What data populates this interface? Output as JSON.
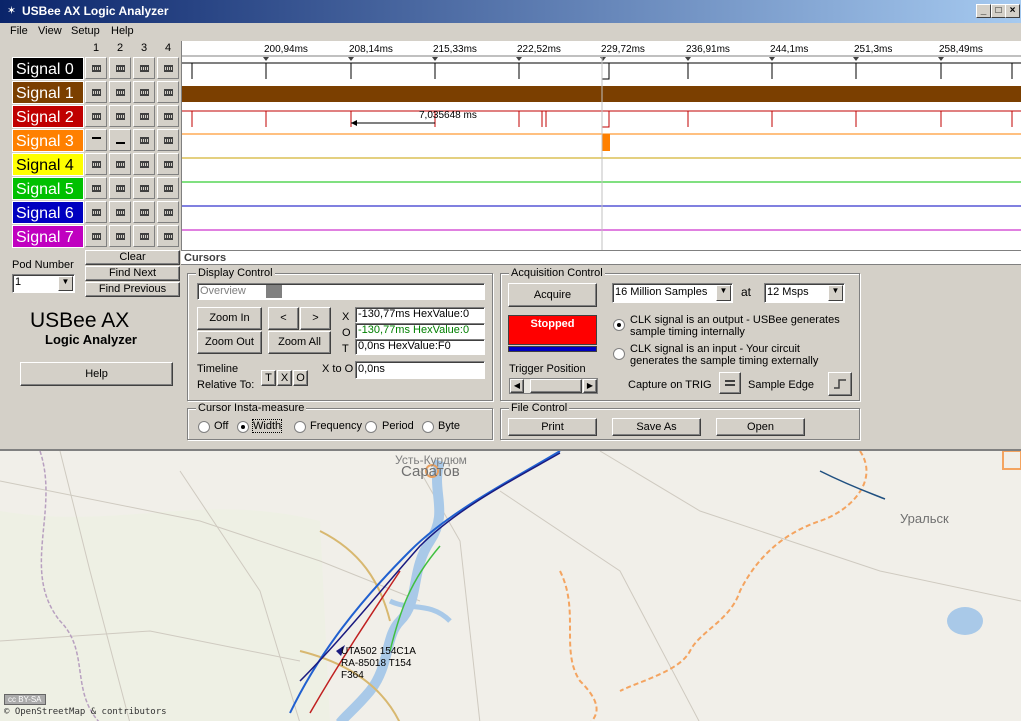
{
  "window": {
    "title": "USBee AX Logic Analyzer",
    "colors": {
      "titlebar": "#0a246a"
    }
  },
  "menu": [
    "File",
    "View",
    "Setup",
    "Help"
  ],
  "column_numbers": [
    "1",
    "2",
    "3",
    "4"
  ],
  "signals": [
    {
      "label": "Signal 0",
      "color": "#000000"
    },
    {
      "label": "Signal 1",
      "color": "#7b3f00"
    },
    {
      "label": "Signal 2",
      "color": "#c00000"
    },
    {
      "label": "Signal 3",
      "color": "#ff8000"
    },
    {
      "label": "Signal 4",
      "color": "#ffff00"
    },
    {
      "label": "Signal 5",
      "color": "#00c000"
    },
    {
      "label": "Signal 6",
      "color": "#0000c0"
    },
    {
      "label": "Signal 7",
      "color": "#c000c0"
    }
  ],
  "timeline": {
    "ticks": [
      "200,94ms",
      "208,14ms",
      "215,33ms",
      "222,52ms",
      "229,72ms",
      "236,91ms",
      "244,1ms",
      "251,3ms",
      "258,49ms"
    ],
    "measurement": "7,035648 ms",
    "cursors_label": "Cursors"
  },
  "side": {
    "clear": "Clear",
    "find_next": "Find Next",
    "find_previous": "Find Previous",
    "pod_number_label": "Pod Number",
    "pod_number_value": "1",
    "brand_title": "USBee AX",
    "brand_sub": "Logic Analyzer",
    "help": "Help"
  },
  "display_control": {
    "title": "Display Control",
    "overview_placeholder": "Overview",
    "zoom_in": "Zoom In",
    "zoom_out": "Zoom Out",
    "zoom_all": "Zoom All",
    "left_arrow": "<",
    "right_arrow": ">",
    "cursor_x_label": "X",
    "cursor_x_value": "-130,77ms HexValue:0",
    "cursor_o_label": "O",
    "cursor_o_value": "-130,77ms HexValue:0",
    "cursor_t_label": "T",
    "cursor_t_value": "0,0ns HexValue:F0",
    "timeline_label": "Timeline",
    "relative_to_label": "Relative To:",
    "rel_t": "T",
    "rel_x": "X",
    "rel_o": "O",
    "x_to_o_label": "X to O",
    "x_to_o_value": "0,0ns"
  },
  "insta_measure": {
    "title": "Cursor Insta-measure",
    "options": [
      "Off",
      "Width",
      "Frequency",
      "Period",
      "Byte"
    ],
    "selected": "Width"
  },
  "acquisition": {
    "title": "Acquisition Control",
    "acquire": "Acquire",
    "samples": "16 Million Samples",
    "at": "at",
    "rate": "12 Msps",
    "status": "Stopped",
    "status_color": "#ff0000",
    "clk_output": "CLK signal is an output - USBee generates sample timing internally",
    "clk_input": "CLK signal is an input - Your circuit generates the sample timing externally",
    "trigger_position": "Trigger Position",
    "capture_on_trig": "Capture on TRIG",
    "sample_edge": "Sample Edge"
  },
  "file_control": {
    "title": "File Control",
    "print": "Print",
    "save_as": "Save As",
    "open": "Open"
  },
  "map": {
    "cities": [
      "Усть-Курдюм",
      "Саратов",
      "Уральск"
    ],
    "aircraft_label_1": "UTA502 154C1A",
    "aircraft_label_2": "RA-85018 T154",
    "aircraft_label_3": "F364",
    "license_badge": "cc BY-SA",
    "attribution": "© OpenStreetMap & contributors"
  }
}
